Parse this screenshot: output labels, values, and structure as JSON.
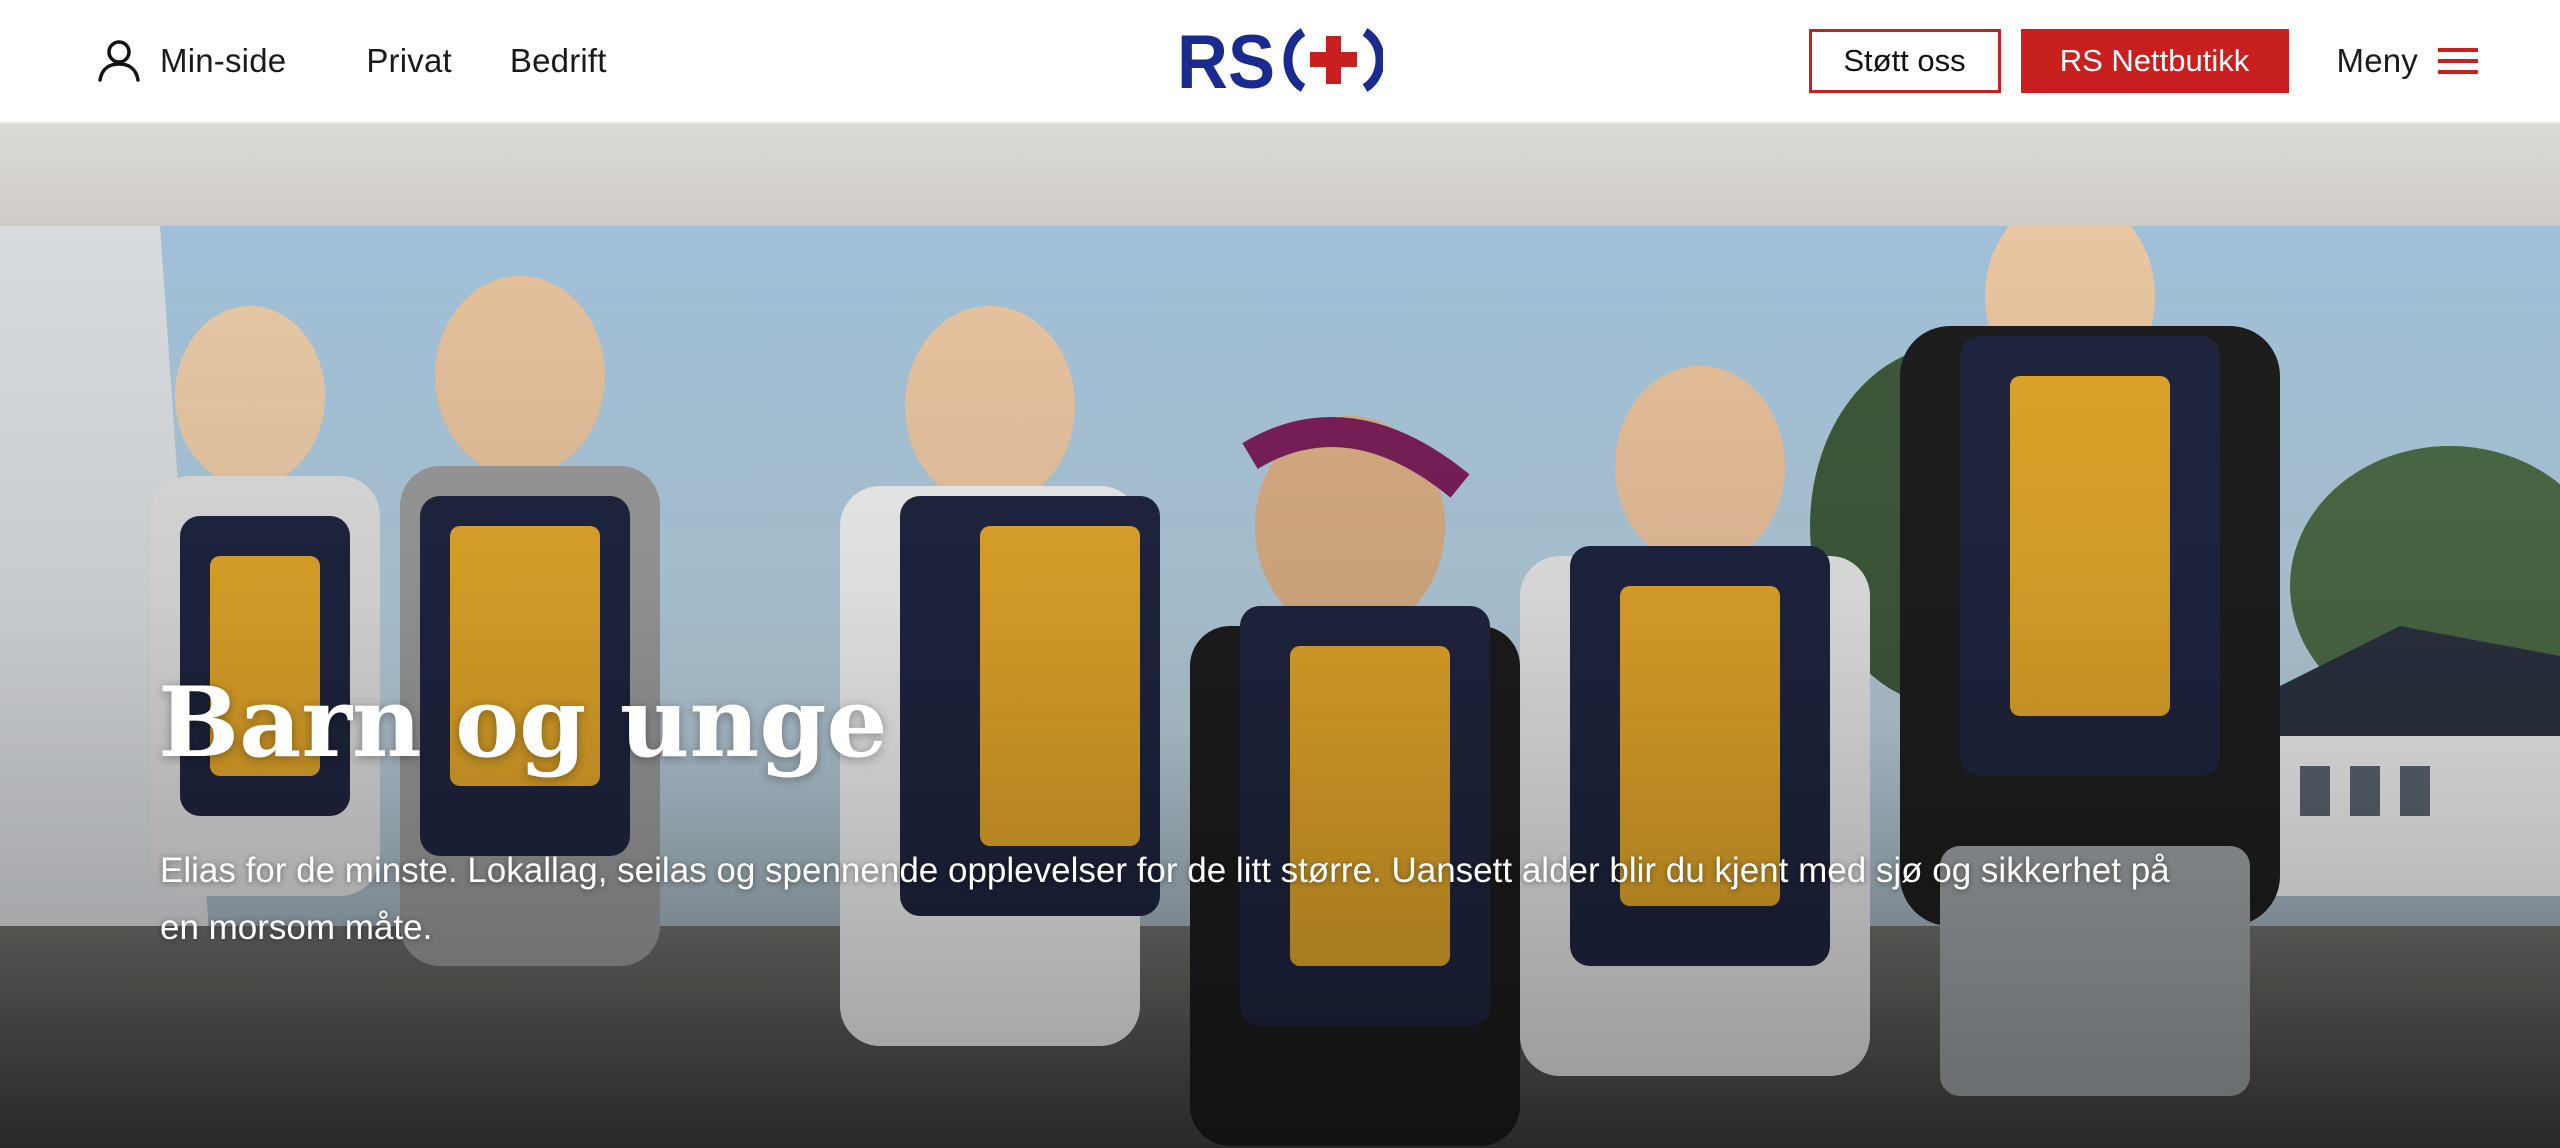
{
  "header": {
    "min_side_label": "Min-side",
    "nav": [
      {
        "label": "Privat"
      },
      {
        "label": "Bedrift"
      }
    ],
    "logo_text": "RS",
    "support_label": "Støtt oss",
    "shop_label": "RS Nettbutikk",
    "menu_label": "Meny",
    "icons": {
      "user": "user-icon",
      "menu": "hamburger-icon",
      "logo_cross": "red-cross-icon"
    }
  },
  "hero": {
    "title": "Barn og unge",
    "text": "Elias for de minste. Lokallag, seilas og spennende opplevelser for de litt større. Uansett alder blir du kjent med sjø og sikkerhet på en morsom måte."
  },
  "colors": {
    "brand_red": "#c8201f",
    "brand_navy": "#1a2b8f",
    "header_bg": "#ffffff",
    "band_grey": "#d6d4d0"
  }
}
